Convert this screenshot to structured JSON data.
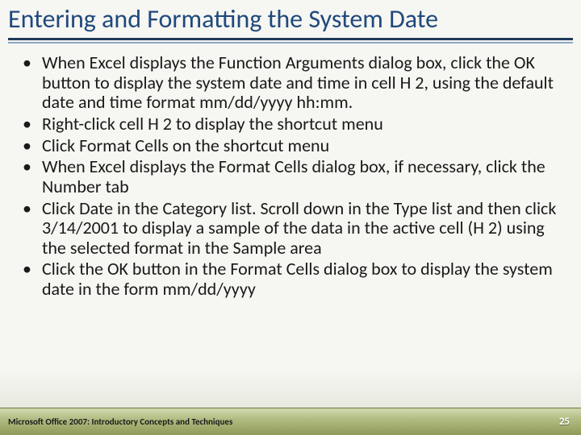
{
  "title": "Entering and Formatting the System Date",
  "bullets": [
    "When Excel displays the Function Arguments dialog box, click the OK button to display the system date and time in cell H 2, using the default date and time format mm/dd/yyyy hh:mm.",
    "Right-click cell H 2 to display the shortcut menu",
    "Click Format Cells on the shortcut menu",
    "When Excel displays the Format Cells dialog box, if necessary, click the Number tab",
    "Click Date in the Category list. Scroll down in the Type list and then click 3/14/2001 to display a sample of the data in the active cell (H 2) using the selected format in the Sample area",
    "Click the OK button in the Format Cells dialog box to display the system date in the form mm/dd/yyyy"
  ],
  "footer": {
    "text": "Microsoft Office 2007: Introductory Concepts and Techniques",
    "page": "25"
  }
}
